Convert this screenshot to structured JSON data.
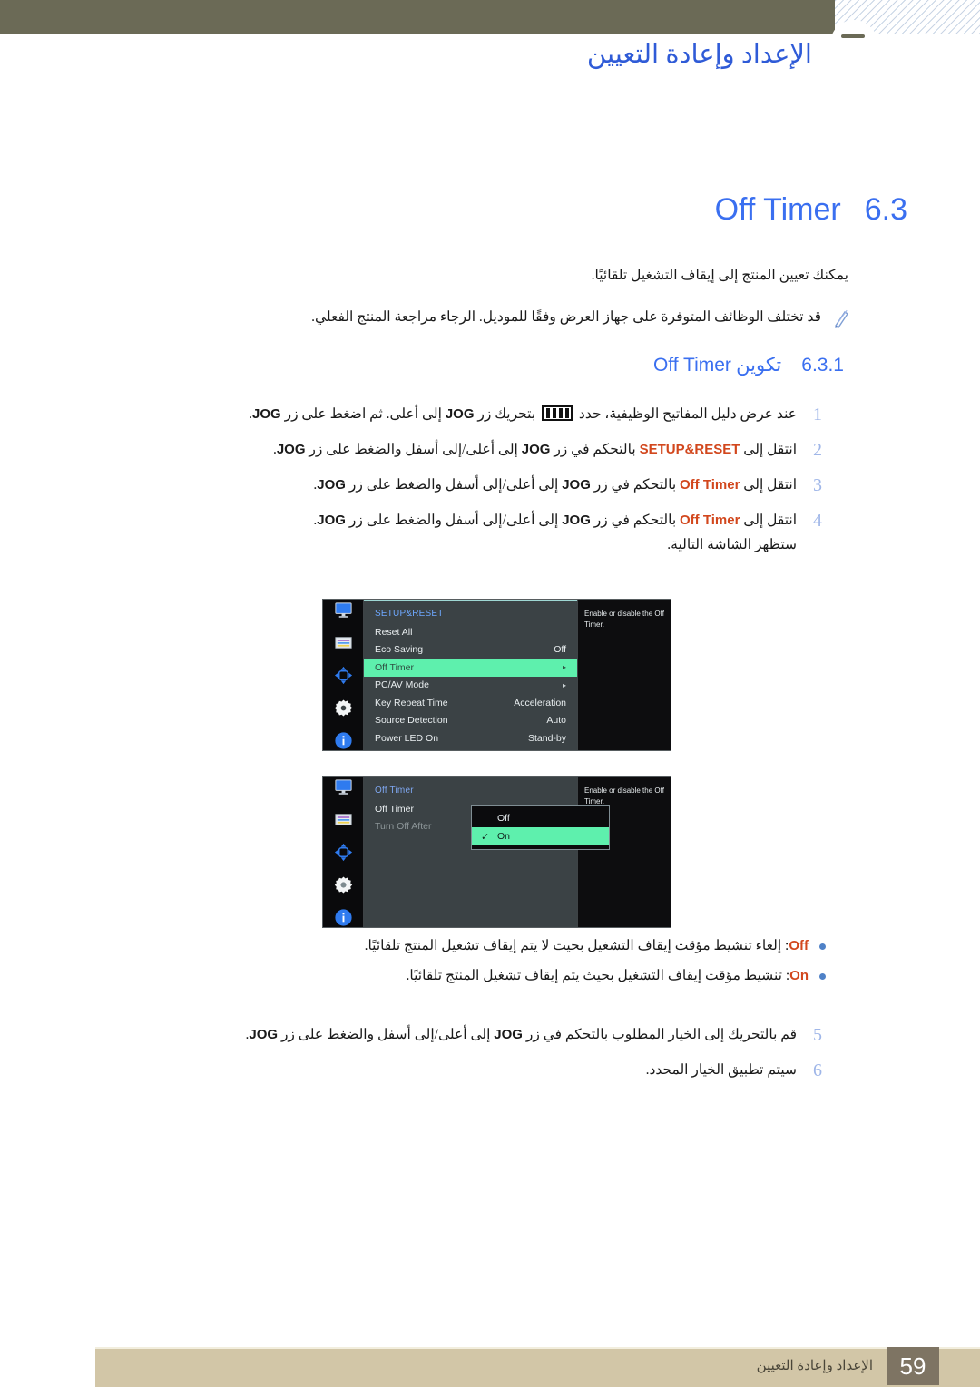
{
  "header": {
    "chapter_title": "الإعداد وإعادة التعيين",
    "band_color": "#6b6a56",
    "title_color": "#2f5bd7"
  },
  "section": {
    "number": "6.3",
    "title_en": "Off Timer",
    "intro": "يمكنك تعيين المنتج إلى إيقاف التشغيل تلقائيًا.",
    "note": "قد تختلف الوظائف المتوفرة على جهاز العرض وفقًا للموديل. الرجاء مراجعة المنتج الفعلي.",
    "note_icon": "pencil-note-icon"
  },
  "subsection": {
    "number": "6.3.1",
    "label_ar": "تكوين",
    "label_en": "Off Timer"
  },
  "steps_top": [
    {
      "index": "1",
      "pre": "عند عرض دليل المفاتيح الوظيفية، حدد",
      "glyph": "function-key-guide-icon",
      "mid": "بتحريك زر",
      "kw1": "JOG",
      "post": "إلى أعلى. ثم اضغط على زر",
      "kw2": "JOG",
      "end": "."
    },
    {
      "index": "2",
      "pre": "انتقل إلى",
      "kw_orange": "SETUP&RESET",
      "mid": "بالتحكم في زر",
      "kw1": "JOG",
      "post": "إلى أعلى/إلى أسفل والضغط على زر",
      "kw2": "JOG",
      "end": "."
    },
    {
      "index": "3",
      "pre": "انتقل إلى",
      "kw_orange": "Off Timer",
      "mid": "بالتحكم في زر",
      "kw1": "JOG",
      "post": "إلى أعلى/إلى أسفل والضغط على زر",
      "kw2": "JOG",
      "end": "."
    },
    {
      "index": "4",
      "pre": "انتقل إلى",
      "kw_orange": "Off Timer",
      "mid": "بالتحكم في زر",
      "kw1": "JOG",
      "post": "إلى أعلى/إلى أسفل والضغط على زر",
      "kw2": "JOG",
      "end": ".",
      "extra": "ستظهر الشاشة التالية."
    }
  ],
  "steps_bottom": [
    {
      "index": "5",
      "pre": "قم بالتحريك إلى الخيار المطلوب بالتحكم في زر",
      "kw1": "JOG",
      "post": "إلى أعلى/إلى أسفل والضغط على زر",
      "kw2": "JOG",
      "end": "."
    },
    {
      "index": "6",
      "text": "سيتم تطبيق الخيار المحدد."
    }
  ],
  "bullets": [
    {
      "keyword": "Off",
      "text": ": إلغاء تنشيط مؤقت إيقاف التشغيل بحيث لا يتم إيقاف تشغيل المنتج تلقائيًا."
    },
    {
      "keyword": "On",
      "text": ": تنشيط مؤقت إيقاف التشغيل بحيث يتم إيقاف تشغيل المنتج تلقائيًا."
    }
  ],
  "osd_1": {
    "menu_title": "SETUP&RESET",
    "rail_icons": [
      "monitor-icon",
      "picture-bars-icon",
      "directional-pad-icon",
      "gear-icon",
      "info-icon"
    ],
    "rows": [
      {
        "label": "Reset All",
        "value": "",
        "arrow": "",
        "selected": false
      },
      {
        "label": "Eco Saving",
        "value": "Off",
        "arrow": "",
        "selected": false
      },
      {
        "label": "Off Timer",
        "value": "",
        "arrow": "▸",
        "selected": true
      },
      {
        "label": "PC/AV Mode",
        "value": "",
        "arrow": "▸",
        "selected": false
      },
      {
        "label": "Key Repeat Time",
        "value": "Acceleration",
        "arrow": "",
        "selected": false
      },
      {
        "label": "Source Detection",
        "value": "Auto",
        "arrow": "",
        "selected": false
      },
      {
        "label": "Power LED On",
        "value": "Stand-by",
        "arrow": "",
        "selected": false
      }
    ],
    "help_text": "Enable or disable the Off Timer.",
    "highlight_color": "#5ef0ad"
  },
  "osd_2": {
    "menu_title": "Off Timer",
    "rail_icons": [
      "monitor-icon",
      "picture-bars-icon",
      "directional-pad-icon",
      "gear-icon",
      "info-icon"
    ],
    "rows": [
      {
        "label": "Off Timer",
        "dim": false
      },
      {
        "label": "Turn Off After",
        "dim": true
      }
    ],
    "dropdown": [
      {
        "label": "Off",
        "checked": false,
        "selected": false
      },
      {
        "label": "On",
        "checked": true,
        "selected": true
      }
    ],
    "check_glyph": "✓",
    "help_text": "Enable or disable the Off Timer.",
    "highlight_color": "#5ef0ad"
  },
  "footer": {
    "page_number": "59",
    "caption": "الإعداد وإعادة التعيين",
    "bar_color": "#d2c6a7",
    "page_box_color": "#7e7463"
  }
}
